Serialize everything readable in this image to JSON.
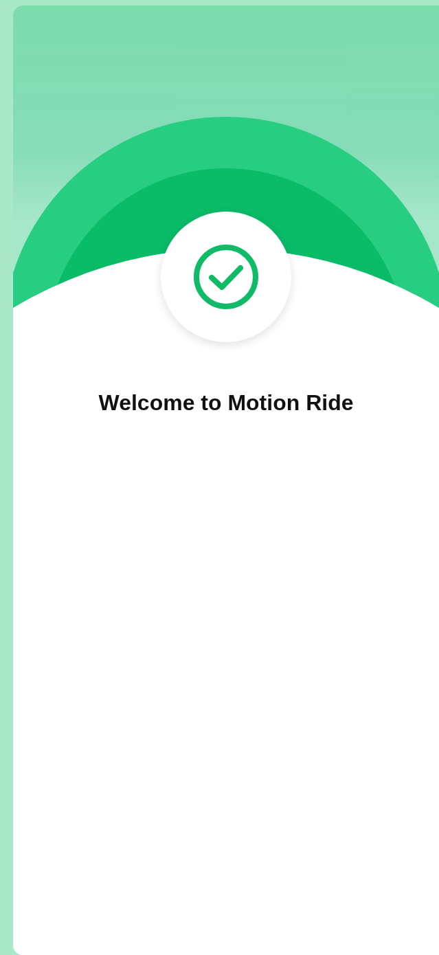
{
  "title": "Welcome to Motion Ride"
}
